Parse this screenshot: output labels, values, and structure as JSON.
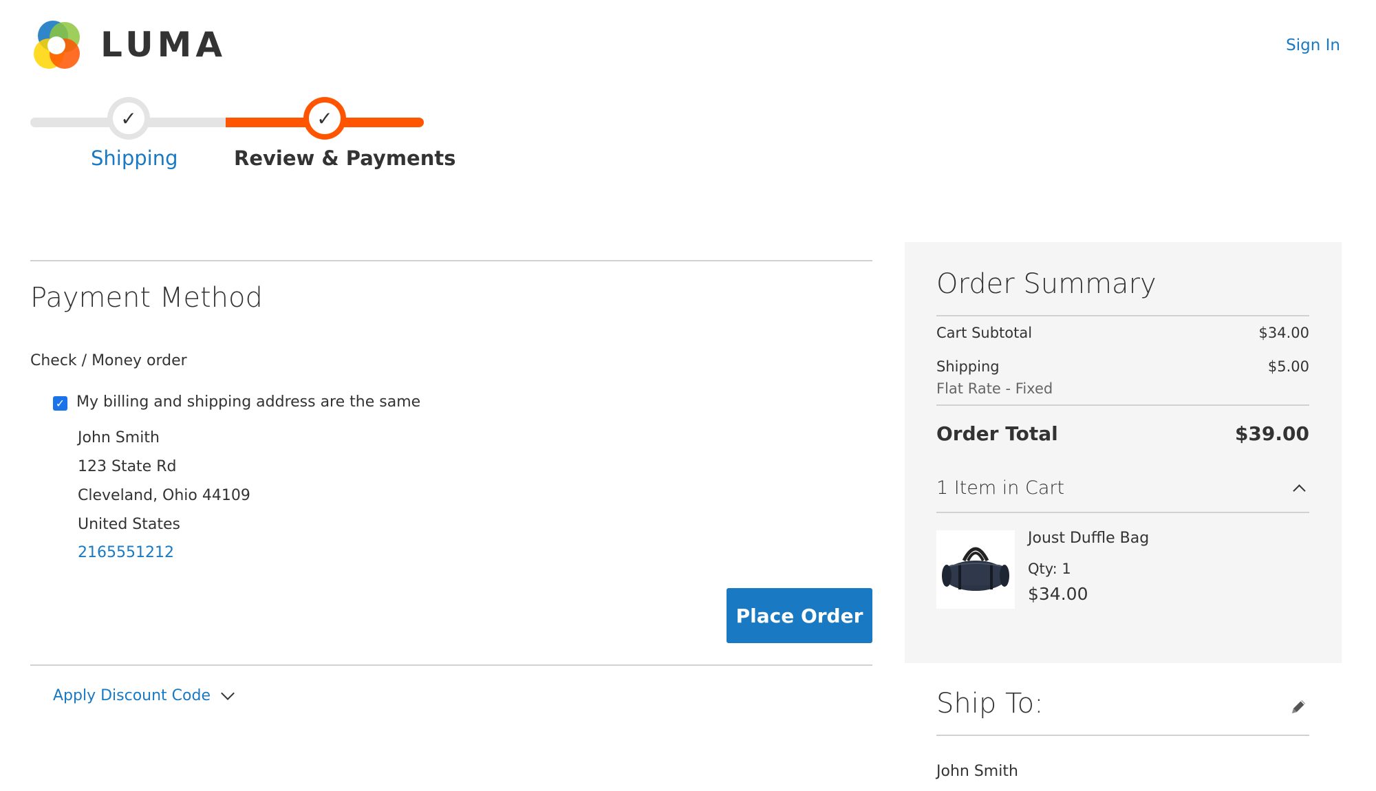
{
  "header": {
    "brand": "LUMA",
    "sign_in": "Sign In",
    "logo_colors": [
      "#1979c3",
      "#8dc63f",
      "#ff5501",
      "#ffd400"
    ]
  },
  "progress": {
    "steps": [
      {
        "label": "Shipping",
        "state": "complete"
      },
      {
        "label": "Review & Payments",
        "state": "active"
      }
    ],
    "check_glyph": "✓",
    "accent": "#ff5501"
  },
  "payment": {
    "title": "Payment Method",
    "option": "Check / Money order",
    "same_address_label": "My billing and shipping address are the same",
    "same_address_checked": true,
    "address": {
      "name": "John Smith",
      "street": "123 State Rd",
      "city_line": "Cleveland, Ohio 44109",
      "country": "United States",
      "phone": "2165551212"
    },
    "place_order": "Place Order",
    "discount_label": "Apply Discount Code"
  },
  "summary": {
    "title": "Order Summary",
    "subtotal_label": "Cart Subtotal",
    "subtotal_value": "$34.00",
    "shipping_label": "Shipping",
    "shipping_value": "$5.00",
    "shipping_method": "Flat Rate - Fixed",
    "total_label": "Order Total",
    "total_value": "$39.00",
    "items_toggle": "1 Item in Cart",
    "item": {
      "name": "Joust Duffle Bag",
      "qty": "Qty: 1",
      "price": "$34.00",
      "image": "duffle-bag"
    }
  },
  "ship_to": {
    "title": "Ship To:",
    "name": "John Smith",
    "edit_icon": "pencil-icon"
  }
}
